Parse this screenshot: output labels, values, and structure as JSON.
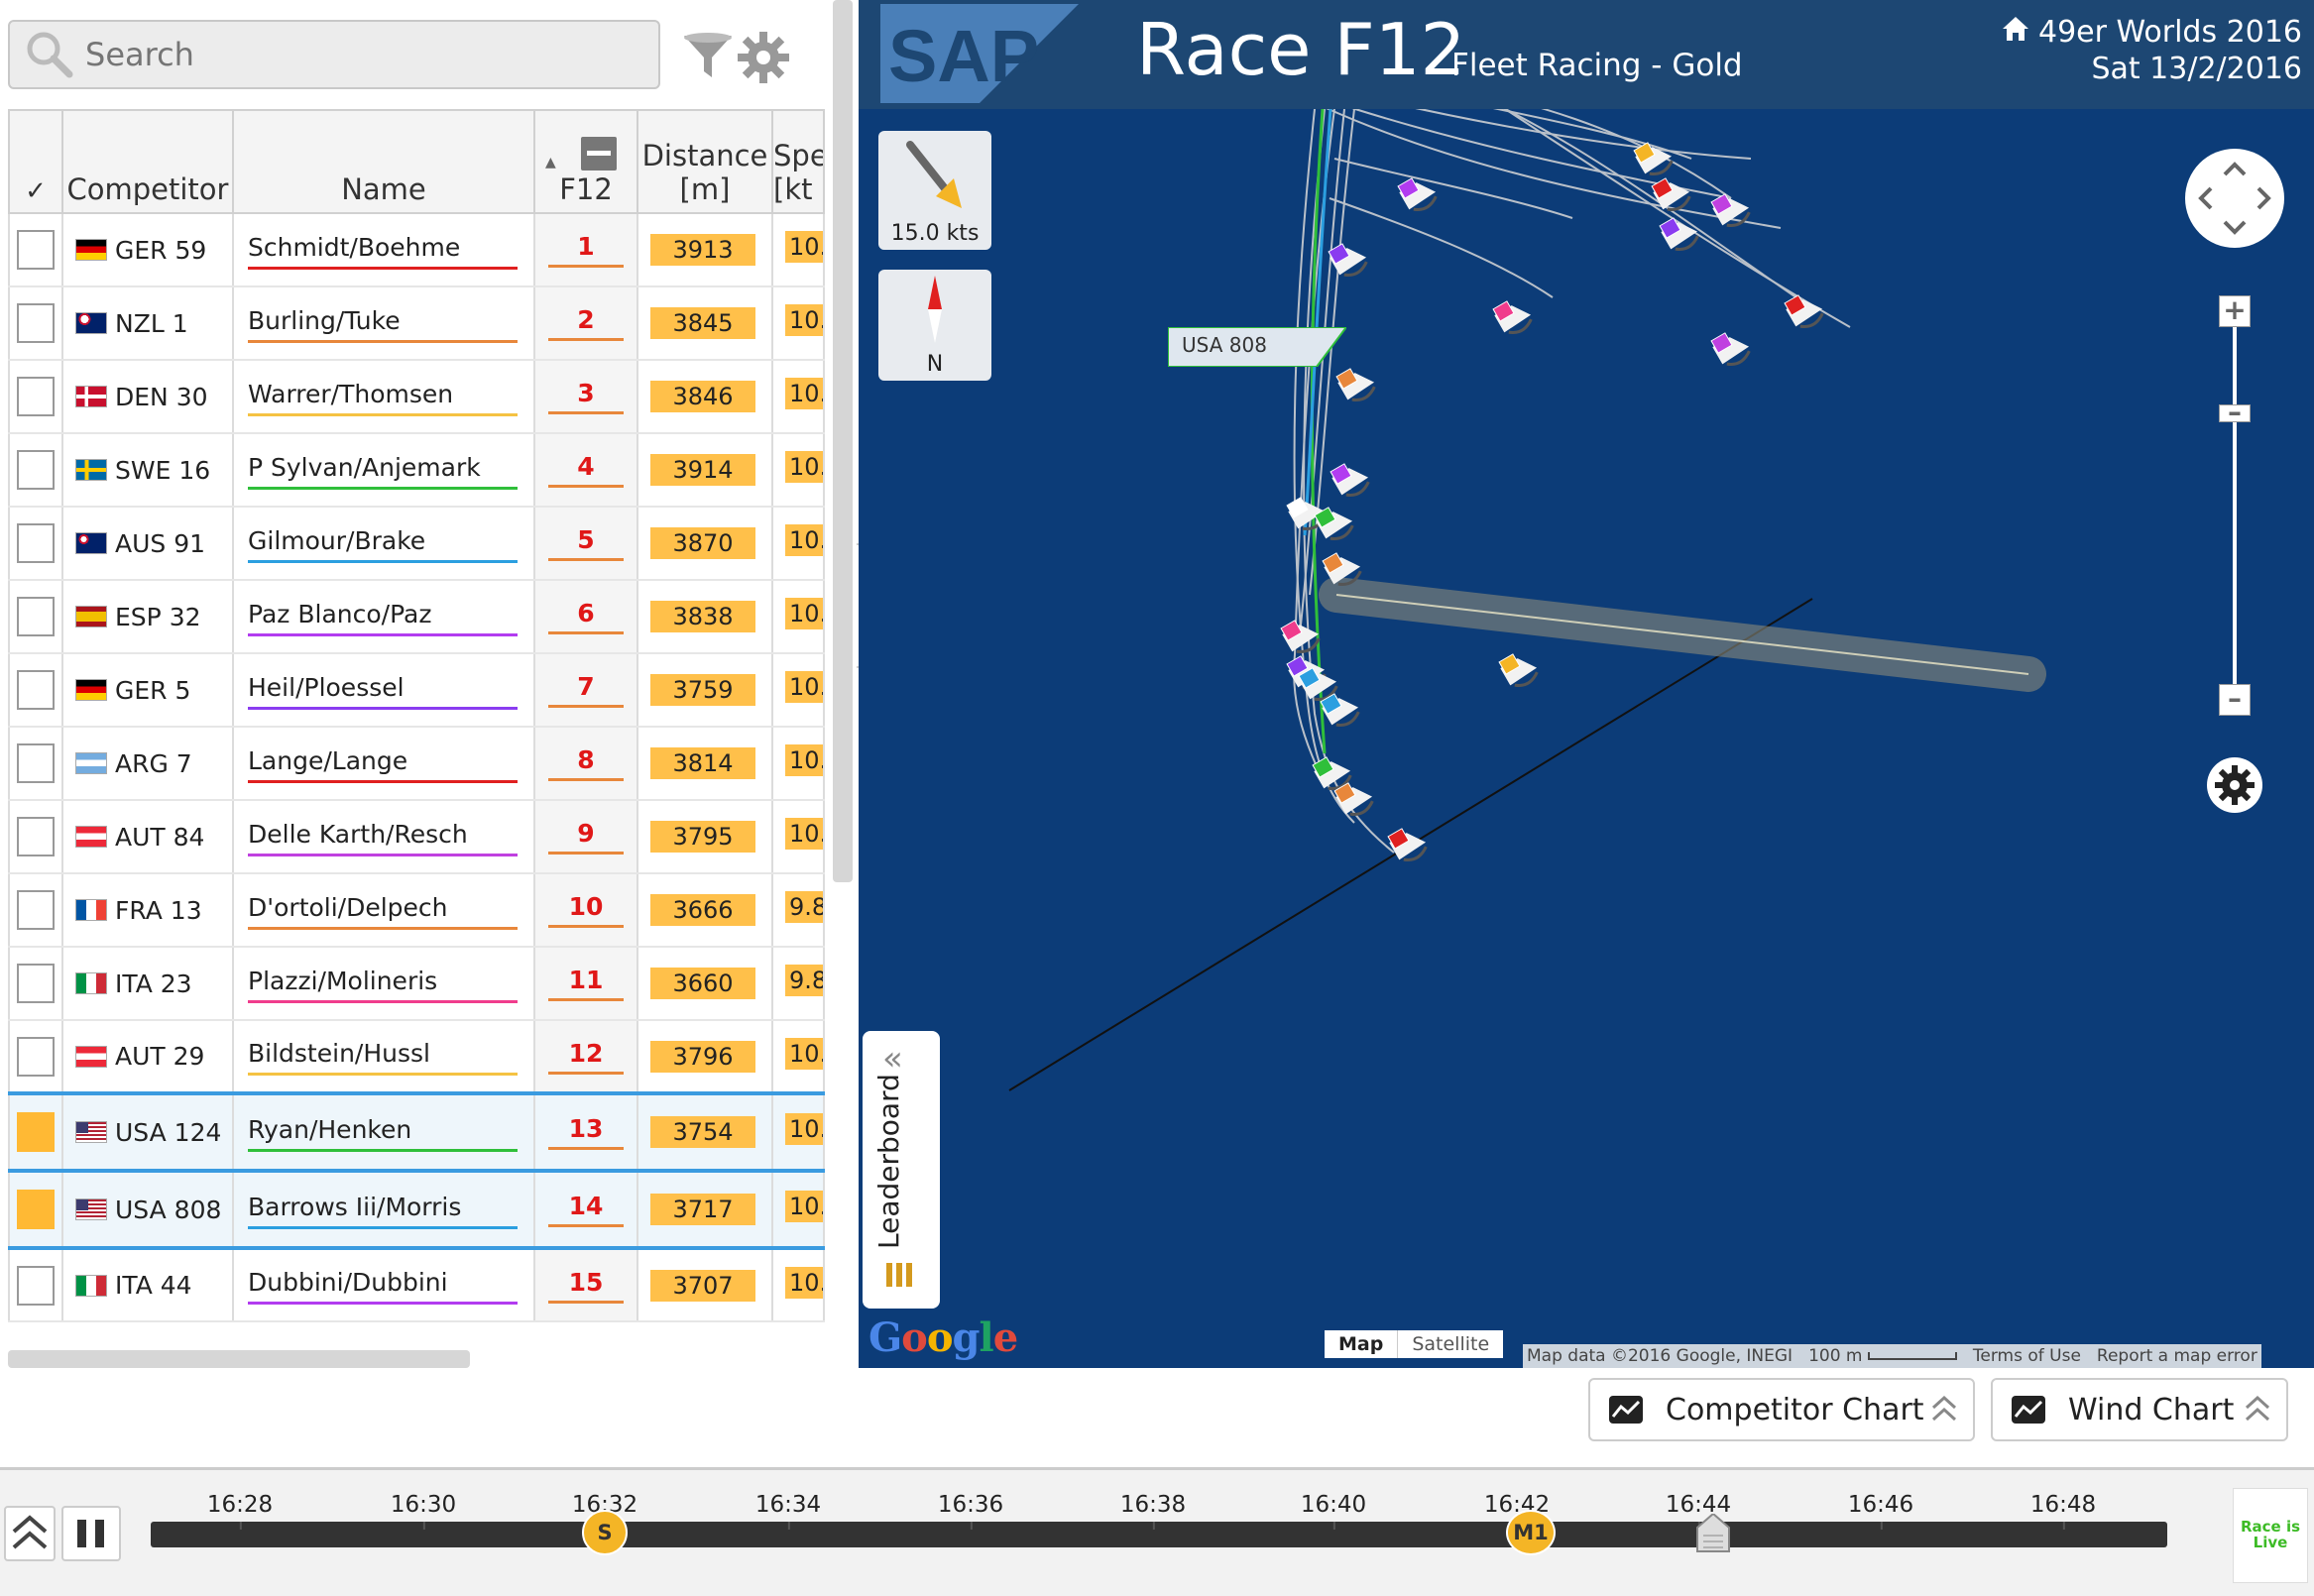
{
  "search": {
    "placeholder": "Search"
  },
  "table": {
    "headers": {
      "check": "✓",
      "competitor": "Competitor",
      "name": "Name",
      "rank_col": "F12",
      "distance": "Distance\n[m]",
      "speed": "Spe\n[kt"
    },
    "rows": [
      {
        "sail": "GER 59",
        "flag": "ger",
        "name": "Schmidt/Boehme",
        "color": "#e02020",
        "rank": "1",
        "dist": "3913",
        "spd": "10.",
        "sel": false
      },
      {
        "sail": "NZL 1",
        "flag": "nzl",
        "name": "Burling/Tuke",
        "color": "#e8873b",
        "rank": "2",
        "dist": "3845",
        "spd": "10.",
        "sel": false
      },
      {
        "sail": "DEN 30",
        "flag": "den",
        "name": "Warrer/Thomsen",
        "color": "#f5c242",
        "rank": "3",
        "dist": "3846",
        "spd": "10.",
        "sel": false
      },
      {
        "sail": "SWE 16",
        "flag": "swe",
        "name": "P Sylvan/Anjemark",
        "color": "#2fbf3a",
        "rank": "4",
        "dist": "3914",
        "spd": "10.",
        "sel": false
      },
      {
        "sail": "AUS 91",
        "flag": "aus",
        "name": "Gilmour/Brake",
        "color": "#2b9fe0",
        "rank": "5",
        "dist": "3870",
        "spd": "10.",
        "sel": false
      },
      {
        "sail": "ESP 32",
        "flag": "esp",
        "name": "Paz Blanco/Paz",
        "color": "#b23cf0",
        "rank": "6",
        "dist": "3838",
        "spd": "10.",
        "sel": false
      },
      {
        "sail": "GER 5",
        "flag": "ger",
        "name": "Heil/Ploessel",
        "color": "#8a3cf0",
        "rank": "7",
        "dist": "3759",
        "spd": "10.",
        "sel": false
      },
      {
        "sail": "ARG 7",
        "flag": "arg",
        "name": "Lange/Lange",
        "color": "#e02020",
        "rank": "8",
        "dist": "3814",
        "spd": "10.",
        "sel": false
      },
      {
        "sail": "AUT 84",
        "flag": "aut",
        "name": "Delle Karth/Resch",
        "color": "#c040e0",
        "rank": "9",
        "dist": "3795",
        "spd": "10.",
        "sel": false
      },
      {
        "sail": "FRA 13",
        "flag": "fra",
        "name": "D'ortoli/Delpech",
        "color": "#e8873b",
        "rank": "10",
        "dist": "3666",
        "spd": "9.8",
        "sel": false
      },
      {
        "sail": "ITA 23",
        "flag": "ita",
        "name": "Plazzi/Molineris",
        "color": "#f03c8c",
        "rank": "11",
        "dist": "3660",
        "spd": "9.8",
        "sel": false
      },
      {
        "sail": "AUT 29",
        "flag": "aut",
        "name": "Bildstein/Hussl",
        "color": "#f5c242",
        "rank": "12",
        "dist": "3796",
        "spd": "10.",
        "sel": false
      },
      {
        "sail": "USA 124",
        "flag": "usa",
        "name": "Ryan/Henken",
        "color": "#2fbf3a",
        "rank": "13",
        "dist": "3754",
        "spd": "10.",
        "sel": true
      },
      {
        "sail": "USA 808",
        "flag": "usa",
        "name": "Barrows Iii/Morris",
        "color": "#2b9fe0",
        "rank": "14",
        "dist": "3717",
        "spd": "10.",
        "sel": true
      },
      {
        "sail": "ITA 44",
        "flag": "ita",
        "name": "Dubbini/Dubbini",
        "color": "#b23cf0",
        "rank": "15",
        "dist": "3707",
        "spd": "10.",
        "sel": false
      }
    ]
  },
  "map": {
    "logo": "SAP",
    "race_title": "Race F12",
    "race_subtitle": "Fleet Racing - Gold",
    "event": "49er Worlds 2016",
    "date": "Sat 13/2/2016",
    "wind_label": "15.0 kts",
    "north_label": "N",
    "leaderboard_tab": "Leaderboard",
    "boat_label": "USA 808",
    "map_type": {
      "map": "Map",
      "satellite": "Satellite"
    },
    "attribution": {
      "data": "Map data ©2016 Google, INEGI",
      "scale": "100 m",
      "terms": "Terms of Use",
      "report": "Report a map error"
    },
    "google": "Google"
  },
  "charts": {
    "competitor": "Competitor Chart",
    "wind": "Wind Chart"
  },
  "timeline": {
    "ticks": [
      "16:28",
      "16:30",
      "16:32",
      "16:34",
      "16:36",
      "16:38",
      "16:40",
      "16:42",
      "16:44",
      "16:46",
      "16:48"
    ],
    "start_marker": "S",
    "mark_marker": "M1",
    "live": "Race is Live"
  },
  "colors": {
    "header": "#1d4773",
    "water": "#0c3c78",
    "accent": "#ffc04a",
    "selected": "#3a9be0"
  }
}
